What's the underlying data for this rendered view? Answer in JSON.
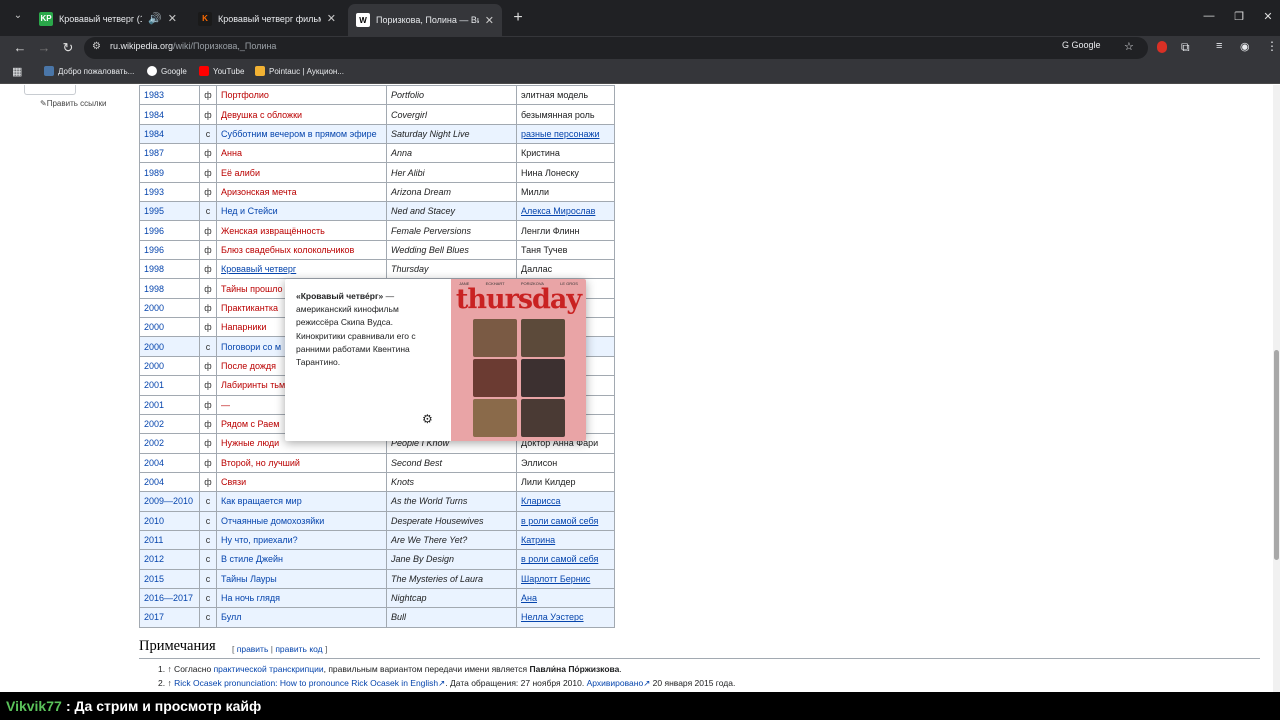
{
  "browser": {
    "tabs": [
      {
        "title": "Кровавый четверг (1998) с",
        "favicon": "KP",
        "favcolor": "#2aa84a"
      },
      {
        "title": "Кровавый четверг фильм, 199",
        "favicon": "K",
        "favcolor": "#ff6a00"
      },
      {
        "title": "Поризкова, Полина — Википе",
        "favicon": "W",
        "favcolor": "#ffffff"
      }
    ],
    "url_host": "ru.wikipedia.org",
    "url_path": "/wiki/Поризкова,_Полина",
    "search_chip": "Google",
    "bookmarks": [
      {
        "label": "Добро пожаловать...",
        "color": "#4a76a8"
      },
      {
        "label": "Google",
        "color": "#ffffff"
      },
      {
        "label": "YouTube",
        "color": "#ff0000"
      },
      {
        "label": "Pointauc | Аукцион...",
        "color": "#f2b233"
      }
    ]
  },
  "page": {
    "edit_links": "Править ссылки",
    "filmography": [
      {
        "year": "1983",
        "type": "ф",
        "ru": "Портфолио",
        "orig": "Portfolio",
        "role": "элитная модель",
        "role_link": false
      },
      {
        "year": "1984",
        "type": "ф",
        "ru": "Девушка с обложки",
        "orig": "Covergirl",
        "role": "безымянная роль",
        "role_link": false
      },
      {
        "year": "1984",
        "type": "с",
        "ru": "Субботним вечером в прямом эфире",
        "orig": "Saturday Night Live",
        "role": "разные персонажи",
        "role_link": true
      },
      {
        "year": "1987",
        "type": "ф",
        "ru": "Анна",
        "orig": "Anna",
        "role": "Кристина",
        "role_link": false
      },
      {
        "year": "1989",
        "type": "ф",
        "ru": "Её алиби",
        "orig": "Her Alibi",
        "role": "Нина Лонеску",
        "role_link": false
      },
      {
        "year": "1993",
        "type": "ф",
        "ru": "Аризонская мечта",
        "orig": "Arizona Dream",
        "role": "Милли",
        "role_link": false
      },
      {
        "year": "1995",
        "type": "с",
        "ru": "Нед и Стейси",
        "orig": "Ned and Stacey",
        "role": "Алекса Мирослав",
        "role_link": true
      },
      {
        "year": "1996",
        "type": "ф",
        "ru": "Женская извращённость",
        "orig": "Female Perversions",
        "role": "Ленгли Флинн",
        "role_link": false
      },
      {
        "year": "1996",
        "type": "ф",
        "ru": "Блюз свадебных колокольчиков",
        "orig": "Wedding Bell Blues",
        "role": "Таня Тучев",
        "role_link": false
      },
      {
        "year": "1998",
        "type": "ф",
        "ru": "Кровавый четверг",
        "orig": "Thursday",
        "role": "Даллас",
        "role_link": false,
        "ru_link": true
      },
      {
        "year": "1998",
        "type": "ф",
        "ru": "Тайны прошло",
        "orig": "",
        "role": "",
        "role_link": false
      },
      {
        "year": "2000",
        "type": "ф",
        "ru": "Практикантка",
        "orig": "",
        "role": "",
        "role_link": false
      },
      {
        "year": "2000",
        "type": "ф",
        "ru": "Напарники",
        "orig": "",
        "role": "гсворт",
        "role_link": false
      },
      {
        "year": "2000",
        "type": "с",
        "ru": "Поговори со м",
        "orig": "",
        "role": "",
        "role_link": false
      },
      {
        "year": "2000",
        "type": "ф",
        "ru": "После дождя",
        "orig": "",
        "role": "алд",
        "role_link": false
      },
      {
        "year": "2001",
        "type": "ф",
        "ru": "Лабиринты тьм",
        "orig": "",
        "role": "",
        "role_link": false
      },
      {
        "year": "2001",
        "type": "ф",
        "ru": "—",
        "orig": "",
        "role": "",
        "role_link": false
      },
      {
        "year": "2002",
        "type": "ф",
        "ru": "Рядом с Раем",
        "orig": "",
        "role": "он",
        "role_link": false
      },
      {
        "year": "2002",
        "type": "ф",
        "ru": "Нужные люди",
        "orig": "People I Know",
        "role": "Доктор Анна Фари",
        "role_link": false
      },
      {
        "year": "2004",
        "type": "ф",
        "ru": "Второй, но лучший",
        "orig": "Second Best",
        "role": "Эллисон",
        "role_link": false
      },
      {
        "year": "2004",
        "type": "ф",
        "ru": "Связи",
        "orig": "Knots",
        "role": "Лили Килдер",
        "role_link": false
      },
      {
        "year": "2009—2010",
        "type": "с",
        "ru": "Как вращается мир",
        "orig": "As the World Turns",
        "role": "Кларисса",
        "role_link": true
      },
      {
        "year": "2010",
        "type": "с",
        "ru": "Отчаянные домохозяйки",
        "orig": "Desperate Housewives",
        "role": "в роли самой себя",
        "role_link": true
      },
      {
        "year": "2011",
        "type": "с",
        "ru": "Ну что, приехали?",
        "orig": "Are We There Yet?",
        "role": "Катрина",
        "role_link": true
      },
      {
        "year": "2012",
        "type": "с",
        "ru": "В стиле Джейн",
        "orig": "Jane By Design",
        "role": "в роли самой себя",
        "role_link": true
      },
      {
        "year": "2015",
        "type": "с",
        "ru": "Тайны Лауры",
        "orig": "The Mysteries of Laura",
        "role": "Шарлотт Бернис",
        "role_link": true
      },
      {
        "year": "2016—2017",
        "type": "с",
        "ru": "На ночь глядя",
        "orig": "Nightcap",
        "role": "Ана",
        "role_link": true
      },
      {
        "year": "2017",
        "type": "с",
        "ru": "Булл",
        "orig": "Bull",
        "role": "Нелла Уэстерс",
        "role_link": true
      }
    ],
    "popup": {
      "title": "«Кровавый четве́рг»",
      "text": " — американский кинофильм режиссёра Скипа Вудса. Кинокритики сравнивали его с ранними работами Квентина Тарантино.",
      "poster_title": "thursday",
      "poster_names": [
        "JANE",
        "ECKHART",
        "PORIZKOVA",
        "LE GROS"
      ]
    },
    "notes": {
      "heading": "Примечания",
      "edit_prefix": "[ ",
      "edit": "править",
      "edit_sep": " | ",
      "edit_code": "править код",
      "edit_suffix": " ]",
      "n1_prefix": "1. ↑ Согласно ",
      "n1_link": "практической транскрипции",
      "n1_mid": ", правильным вариантом передачи имени является ",
      "n1_bold": "Павли́на По́ржизкова",
      "n1_end": ".",
      "n2_prefix": "2. ↑ ",
      "n2_link": "Rick Ocasek pronunciation: How to pronounce Rick Ocasek in English",
      "n2_mid": ". Дата обращения: 27 ноября 2010. ",
      "n2_archive": "Архивировано",
      "n2_end": " 20 января 2015 года."
    }
  },
  "stream_chat": {
    "user": "Vikvik77",
    "message": ": Да стрим и просмотр кайф"
  }
}
